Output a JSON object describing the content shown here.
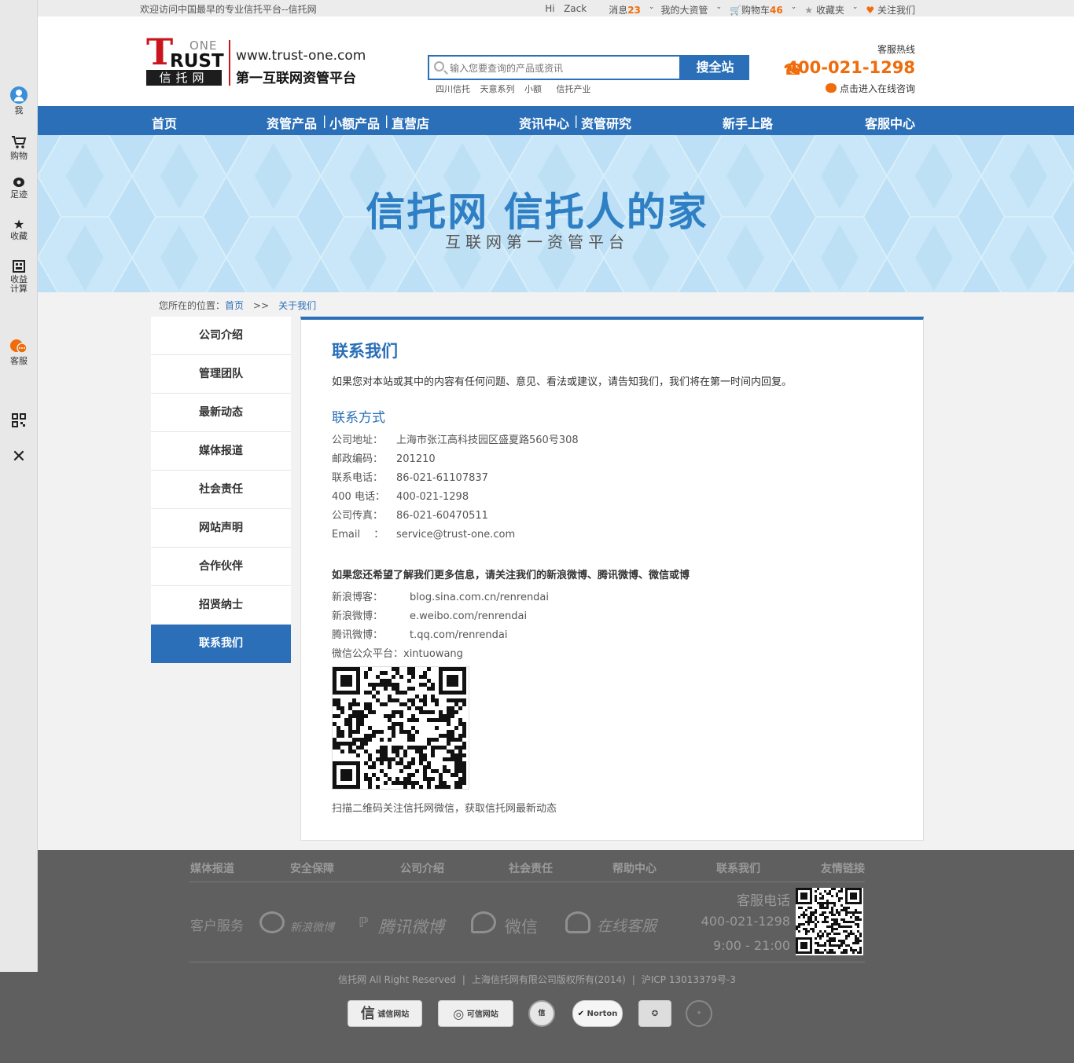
{
  "topbar": {
    "welcome": "欢迎访问中国最早的专业信托平台--信托网",
    "hi": "Hi",
    "username": "Zack",
    "messages_label": "消息",
    "messages_count": "23",
    "my_assets": "我的大资管",
    "cart_label": "购物车",
    "cart_count": "46",
    "favorites": "收藏夹",
    "follow_us": "关注我们"
  },
  "sidebar": {
    "items": [
      {
        "label": "我",
        "icon": "user-icon"
      },
      {
        "label": "购物",
        "icon": "cart-icon"
      },
      {
        "label": "足迹",
        "icon": "eye-icon"
      },
      {
        "label": "收藏",
        "icon": "star-icon"
      },
      {
        "label": "收益",
        "label2": "计算",
        "icon": "calculator-icon"
      },
      {
        "label": "客服",
        "icon": "chat-icon"
      }
    ],
    "qr_icon": "qr-code-icon",
    "close_icon": "close-icon"
  },
  "header": {
    "logo_t": "T",
    "logo_one": "ONE",
    "logo_rust": "RUST",
    "logo_cn": "信托网",
    "url": "www.trust-one.com",
    "slogan": "第一互联网资管平台",
    "search_placeholder": "输入您要查询的产品或资讯",
    "search_button": "搜全站",
    "hot_links": [
      "四川信托",
      "天意系列",
      "小额",
      "信托产业"
    ],
    "hotline_label": "客服热线",
    "hotline_number": "400-021-1298",
    "consult": "点击进入在线咨询"
  },
  "nav": {
    "home": "首页",
    "products": "资管产品",
    "small": "小额产品",
    "direct": "直营店",
    "news": "资讯中心",
    "research": "资管研究",
    "newbie": "新手上路",
    "service": "客服中心",
    "pipe": "|"
  },
  "banner": {
    "title": "信托网 信托人的家",
    "subtitle": "互联网第一资管平台"
  },
  "breadcrumb": {
    "prefix": "您所在的位置：",
    "home": "首页",
    "sep": ">>",
    "current": "关于我们"
  },
  "side_menu": [
    "公司介绍",
    "管理团队",
    "最新动态",
    "媒体报道",
    "社会责任",
    "网站声明",
    "合作伙伴",
    "招贤纳士",
    "联系我们"
  ],
  "content": {
    "title": "联系我们",
    "intro": "如果您对本站或其中的内容有任何问题、意见、看法或建议，请告知我们，我们将在第一时间内回复。",
    "contact_heading": "联系方式",
    "contacts": [
      {
        "k": "公司地址：",
        "v": "上海市张江高科技园区盛夏路560号308"
      },
      {
        "k": "邮政编码：",
        "v": "201210"
      },
      {
        "k": "联系电话：",
        "v": "86-021-61107837"
      },
      {
        "k": "400 电话：",
        "v": "400-021-1298"
      },
      {
        "k": "公司传真：",
        "v": "86-021-60470511"
      },
      {
        "k": "Email　  ：",
        "v": "service@trust-one.com"
      }
    ],
    "social_heading": "如果您还希望了解我们更多信息，请关注我们的新浪微博、腾讯微博、微信或博",
    "social": [
      {
        "k": "新浪博客：",
        "v": "blog.sina.com.cn/renrendai"
      },
      {
        "k": "新浪微博：",
        "v": "e.weibo.com/renrendai"
      },
      {
        "k": "腾讯微博：",
        "v": "t.qq.com/renrendai"
      }
    ],
    "wechat": "微信公众平台：xintuowang",
    "qr_caption": "扫描二维码关注信托网微信，获取信托网最新动态"
  },
  "footer": {
    "links": [
      "媒体报道",
      "安全保障",
      "公司介绍",
      "社会责任",
      "帮助中心",
      "联系我们",
      "友情链接"
    ],
    "service_label": "客户服务",
    "sina": "新浪微博",
    "tencent": "腾讯微博",
    "wechat": "微信",
    "online": "在线客服",
    "phone_label": "客服电话",
    "phone": "400-021-1298",
    "hours": "9:00 - 21:00",
    "copyright1": "信托网 All Right Reserved",
    "copyright2": "上海信托网有限公司版权所有(2014)",
    "copyright3": "沪ICP 13013379号-3",
    "badge1": "诚信网站",
    "badge2": "可信网站",
    "badge_norton": "Norton"
  }
}
